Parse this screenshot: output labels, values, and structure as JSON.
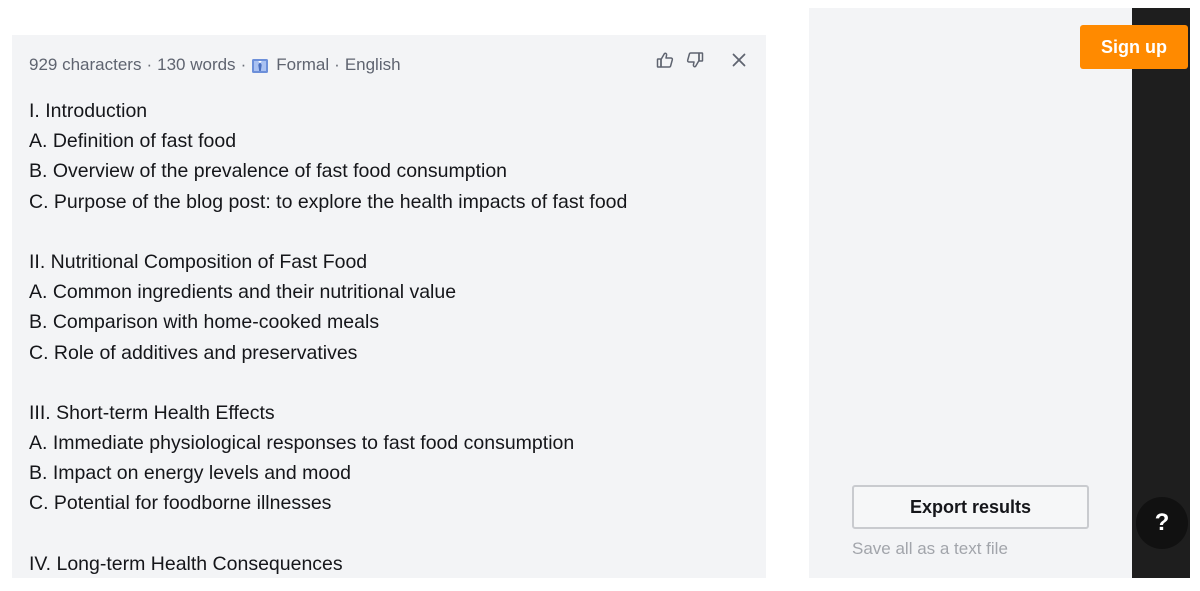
{
  "result": {
    "meta": {
      "characters": "929 characters",
      "words": "130 words",
      "tone_icon": "formal-tone-icon",
      "tone": "Formal",
      "language": "English",
      "separator": "·"
    },
    "actions": {
      "like_icon": "thumbs-up-icon",
      "dislike_icon": "thumbs-down-icon",
      "close_icon": "close-icon"
    },
    "lines": [
      "I. Introduction",
      "A. Definition of fast food",
      "B. Overview of the prevalence of fast food consumption",
      "C. Purpose of the blog post: to explore the health impacts of fast food",
      "",
      "II. Nutritional Composition of Fast Food",
      "A. Common ingredients and their nutritional value",
      "B. Comparison with home-cooked meals",
      "C. Role of additives and preservatives",
      "",
      "III. Short-term Health Effects",
      "A. Immediate physiological responses to fast food consumption",
      "B. Impact on energy levels and mood",
      "C. Potential for foodborne illnesses",
      "",
      "IV. Long-term Health Consequences"
    ]
  },
  "header": {
    "signup_label": "Sign up"
  },
  "export": {
    "button_label": "Export results",
    "hint": "Save all as a text file"
  },
  "help": {
    "label": "?"
  },
  "colors": {
    "accent": "#ff8a00",
    "panel_bg": "#f3f4f6",
    "dark_strip": "#1e1e1e"
  }
}
